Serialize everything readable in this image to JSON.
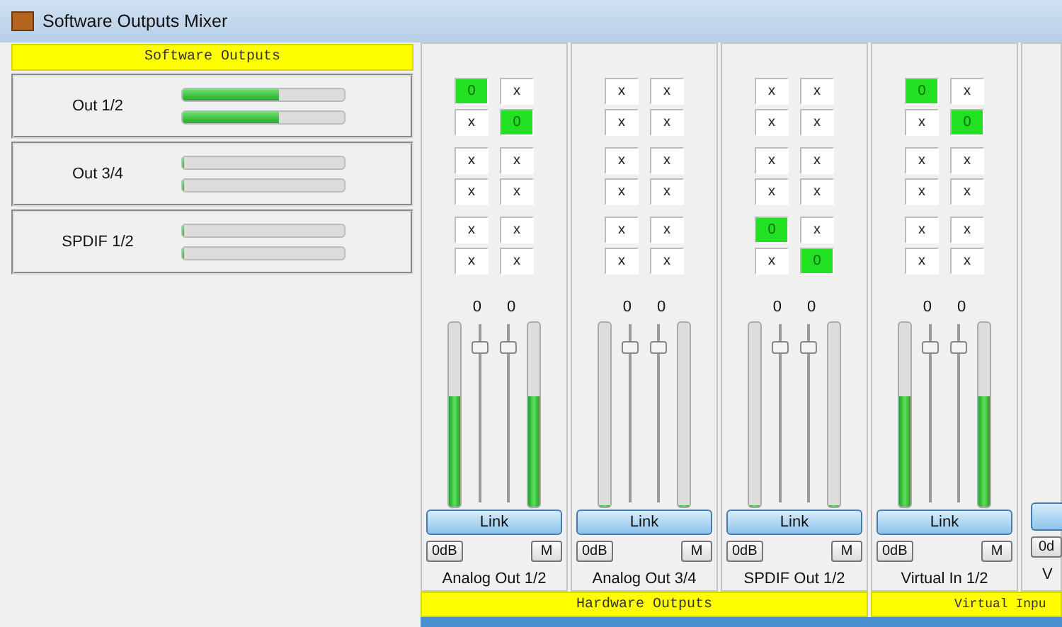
{
  "window": {
    "title": "Software Outputs Mixer"
  },
  "software_outputs": {
    "title": "Software Outputs",
    "channels": [
      {
        "name": "Out 1/2",
        "meters": [
          {
            "level": 0.6
          },
          {
            "level": 0.6
          }
        ]
      },
      {
        "name": "Out 3/4",
        "meters": [
          {
            "level": 0
          },
          {
            "level": 0
          }
        ]
      },
      {
        "name": "SPDIF 1/2",
        "meters": [
          {
            "level": 0
          },
          {
            "level": 0
          }
        ]
      }
    ]
  },
  "strips": [
    {
      "routing": [
        [
          {
            "text": "0",
            "on": true
          },
          {
            "text": "x",
            "on": false
          }
        ],
        [
          {
            "text": "x",
            "on": false
          },
          {
            "text": "0",
            "on": true
          }
        ],
        [
          {
            "text": "x",
            "on": false
          },
          {
            "text": "x",
            "on": false
          }
        ],
        [
          {
            "text": "x",
            "on": false
          },
          {
            "text": "x",
            "on": false
          }
        ],
        [
          {
            "text": "x",
            "on": false
          },
          {
            "text": "x",
            "on": false
          }
        ],
        [
          {
            "text": "x",
            "on": false
          },
          {
            "text": "x",
            "on": false
          }
        ]
      ],
      "readouts": [
        "0",
        "0"
      ],
      "meters": [
        {
          "level": 0.6
        },
        {
          "level": 0.6
        }
      ],
      "faders": [
        {
          "level": 0.9
        },
        {
          "level": 0.9
        }
      ],
      "link": "Link",
      "zero_db": "0dB",
      "mute": "M",
      "name": "Analog Out 1/2"
    },
    {
      "routing": [
        [
          {
            "text": "x",
            "on": false
          },
          {
            "text": "x",
            "on": false
          }
        ],
        [
          {
            "text": "x",
            "on": false
          },
          {
            "text": "x",
            "on": false
          }
        ],
        [
          {
            "text": "x",
            "on": false
          },
          {
            "text": "x",
            "on": false
          }
        ],
        [
          {
            "text": "x",
            "on": false
          },
          {
            "text": "x",
            "on": false
          }
        ],
        [
          {
            "text": "x",
            "on": false
          },
          {
            "text": "x",
            "on": false
          }
        ],
        [
          {
            "text": "x",
            "on": false
          },
          {
            "text": "x",
            "on": false
          }
        ]
      ],
      "readouts": [
        "0",
        "0"
      ],
      "meters": [
        {
          "level": 0
        },
        {
          "level": 0
        }
      ],
      "faders": [
        {
          "level": 0.9
        },
        {
          "level": 0.9
        }
      ],
      "link": "Link",
      "zero_db": "0dB",
      "mute": "M",
      "name": "Analog Out 3/4"
    },
    {
      "routing": [
        [
          {
            "text": "x",
            "on": false
          },
          {
            "text": "x",
            "on": false
          }
        ],
        [
          {
            "text": "x",
            "on": false
          },
          {
            "text": "x",
            "on": false
          }
        ],
        [
          {
            "text": "x",
            "on": false
          },
          {
            "text": "x",
            "on": false
          }
        ],
        [
          {
            "text": "x",
            "on": false
          },
          {
            "text": "x",
            "on": false
          }
        ],
        [
          {
            "text": "0",
            "on": true
          },
          {
            "text": "x",
            "on": false
          }
        ],
        [
          {
            "text": "x",
            "on": false
          },
          {
            "text": "0",
            "on": true
          }
        ]
      ],
      "readouts": [
        "0",
        "0"
      ],
      "meters": [
        {
          "level": 0
        },
        {
          "level": 0
        }
      ],
      "faders": [
        {
          "level": 0.9
        },
        {
          "level": 0.9
        }
      ],
      "link": "Link",
      "zero_db": "0dB",
      "mute": "M",
      "name": "SPDIF Out 1/2"
    },
    {
      "routing": [
        [
          {
            "text": "0",
            "on": true
          },
          {
            "text": "x",
            "on": false
          }
        ],
        [
          {
            "text": "x",
            "on": false
          },
          {
            "text": "0",
            "on": true
          }
        ],
        [
          {
            "text": "x",
            "on": false
          },
          {
            "text": "x",
            "on": false
          }
        ],
        [
          {
            "text": "x",
            "on": false
          },
          {
            "text": "x",
            "on": false
          }
        ],
        [
          {
            "text": "x",
            "on": false
          },
          {
            "text": "x",
            "on": false
          }
        ],
        [
          {
            "text": "x",
            "on": false
          },
          {
            "text": "x",
            "on": false
          }
        ]
      ],
      "readouts": [
        "0",
        "0"
      ],
      "meters": [
        {
          "level": 0.6
        },
        {
          "level": 0.6
        }
      ],
      "faders": [
        {
          "level": 0.9
        },
        {
          "level": 0.9
        }
      ],
      "link": "Link",
      "zero_db": "0dB",
      "mute": "M",
      "name": "Virtual In 1/2"
    }
  ],
  "partial_strip": {
    "zero_db": "0d",
    "name": "V"
  },
  "sections": [
    {
      "title": "Hardware Outputs"
    },
    {
      "title": "Virtual Inpu"
    }
  ]
}
